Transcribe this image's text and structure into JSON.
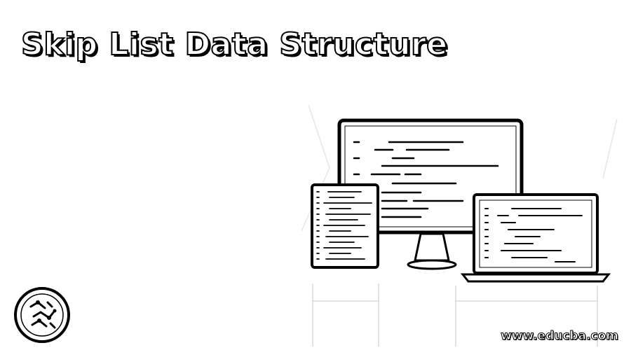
{
  "title": "Skip List Data Structure",
  "brand_url": "www.educba.com",
  "logo_icon": "educba-logo-icon",
  "illustration": "devices-code-icon",
  "colors": {
    "background": "#ffffff",
    "ink": "#000000"
  }
}
